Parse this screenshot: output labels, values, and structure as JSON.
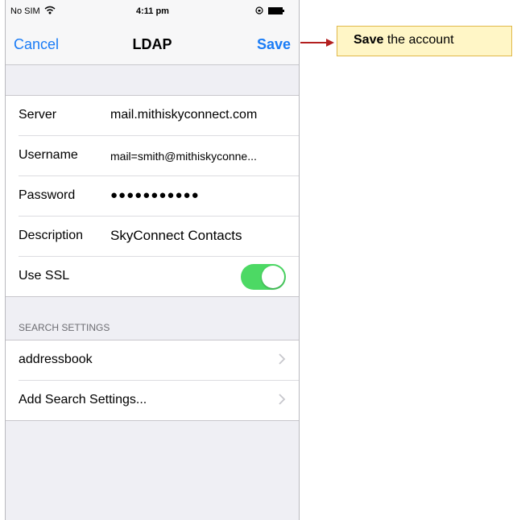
{
  "status_bar": {
    "carrier": "No SIM",
    "wifi_icon": "wifi-icon",
    "time": "4:11 pm",
    "lock_icon": "rotation-lock-icon",
    "battery_icon": "battery-icon"
  },
  "nav": {
    "cancel_label": "Cancel",
    "title": "LDAP",
    "save_label": "Save"
  },
  "account": {
    "rows": [
      {
        "label": "Server",
        "value": "mail.mithiskyconnect.com"
      },
      {
        "label": "Username",
        "value": "mail=smith@mithiskyconne..."
      },
      {
        "label": "Password",
        "value": "●●●●●●●●●●●"
      },
      {
        "label": "Description",
        "value": "SkyConnect Contacts"
      }
    ],
    "ssl": {
      "label": "Use SSL",
      "enabled": true
    }
  },
  "search_settings": {
    "header": "SEARCH SETTINGS",
    "items": [
      {
        "label": "addressbook"
      },
      {
        "label": "Add Search Settings..."
      }
    ]
  },
  "callout": {
    "bold_text": "Save",
    "text": " the account"
  },
  "colors": {
    "accent": "#1a7cf6",
    "toggle_on": "#4cd964",
    "callout_arrow": "#b31f1f",
    "callout_bg": "#fff6c6"
  }
}
